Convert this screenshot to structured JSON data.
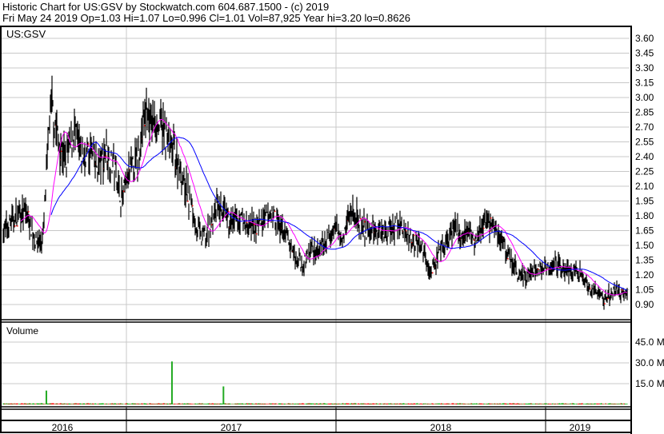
{
  "header": {
    "line1": "Historic Chart for US:GSV by Stockwatch.com 604.687.1500 - (c) 2019",
    "line2": "Fri May 24 2019  Op=1.03  Hi=1.07  Lo=0.996  Cl=1.01  Vol=87,925  Year hi=3.20  lo=0.8626"
  },
  "chart_data": {
    "type": "line",
    "title": "US:GSV",
    "price_axis": {
      "ticks": [
        "3.60",
        "3.45",
        "3.30",
        "3.15",
        "3.00",
        "2.85",
        "2.70",
        "2.55",
        "2.40",
        "2.25",
        "2.10",
        "1.95",
        "1.80",
        "1.65",
        "1.50",
        "1.35",
        "1.20",
        "1.05",
        "0.90"
      ],
      "ylim": [
        0.78,
        3.7
      ]
    },
    "volume_panel": {
      "label": "Volume",
      "ticks": [
        "45.0 M",
        "30.0 M",
        "15.0 M"
      ],
      "ylim": [
        0,
        52
      ],
      "spikes_M": [
        {
          "t": 0.07,
          "v": 10
        },
        {
          "t": 0.27,
          "v": 31
        },
        {
          "t": 0.352,
          "v": 13
        }
      ]
    },
    "x_labels": [
      "2016",
      "2017",
      "2018",
      "2019"
    ],
    "approx_closes_biweekly": [
      1.64,
      1.76,
      1.8,
      1.84,
      1.55,
      1.56,
      3.0,
      2.53,
      2.37,
      2.65,
      2.37,
      2.45,
      2.29,
      2.45,
      2.29,
      1.96,
      2.25,
      2.37,
      2.85,
      2.77,
      2.69,
      2.53,
      2.37,
      2.12,
      1.8,
      1.56,
      1.64,
      1.88,
      1.8,
      1.72,
      1.76,
      1.68,
      1.68,
      1.76,
      1.84,
      1.68,
      1.56,
      1.39,
      1.31,
      1.48,
      1.43,
      1.56,
      1.68,
      1.6,
      1.88,
      1.72,
      1.64,
      1.68,
      1.64,
      1.68,
      1.72,
      1.6,
      1.56,
      1.48,
      1.23,
      1.39,
      1.52,
      1.68,
      1.56,
      1.6,
      1.56,
      1.76,
      1.68,
      1.56,
      1.39,
      1.23,
      1.19,
      1.23,
      1.27,
      1.31,
      1.31,
      1.27,
      1.23,
      1.19,
      1.07,
      1.03,
      0.95,
      1.03,
      1.03,
      1.01
    ],
    "series": [
      {
        "name": "Price OHLC",
        "color": "#000000"
      },
      {
        "name": "Short MA",
        "color": "#ff00ff"
      },
      {
        "name": "Long MA",
        "color": "#0000ff"
      }
    ],
    "grid": true
  }
}
